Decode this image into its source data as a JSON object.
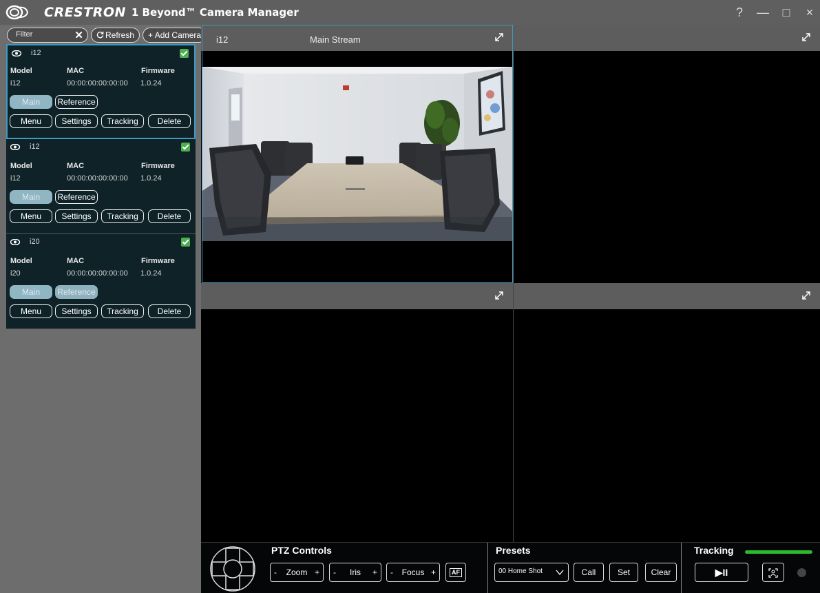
{
  "titlebar": {
    "brand": "CRESTRON",
    "app_title": "1 Beyond™ Camera Manager",
    "help": "?",
    "minimize": "—",
    "maximize": "□",
    "close": "×"
  },
  "toolbar": {
    "filter_placeholder": "Filter",
    "clear": "✕",
    "refresh": "Refresh",
    "add_camera": "+ Add Camera"
  },
  "cameras": [
    {
      "name": "i12",
      "model_label": "Model",
      "mac_label": "MAC",
      "firmware_label": "Firmware",
      "model": "i12",
      "mac": "00:00:00:00:00:00",
      "firmware": "1.0.24",
      "main": "Main",
      "reference": "Reference",
      "menu": "Menu",
      "settings": "Settings",
      "tracking": "Tracking",
      "delete": "Delete"
    },
    {
      "name": "i12",
      "model_label": "Model",
      "mac_label": "MAC",
      "firmware_label": "Firmware",
      "model": "i12",
      "mac": "00:00:00:00:00:00",
      "firmware": "1.0.24",
      "main": "Main",
      "reference": "Reference",
      "menu": "Menu",
      "settings": "Settings",
      "tracking": "Tracking",
      "delete": "Delete"
    },
    {
      "name": "i20",
      "model_label": "Model",
      "mac_label": "MAC",
      "firmware_label": "Firmware",
      "model": "i20",
      "mac": "00:00:00:00:00:00",
      "firmware": "1.0.24",
      "main": "Main",
      "reference": "Reference",
      "menu": "Menu",
      "settings": "Settings",
      "tracking": "Tracking",
      "delete": "Delete"
    }
  ],
  "viewer": {
    "camera": "i12",
    "stream": "Main Stream"
  },
  "ptz": {
    "title": "PTZ Controls",
    "zoom": "Zoom",
    "iris": "Iris",
    "focus": "Focus",
    "minus": "-",
    "plus": "+",
    "af": "AF"
  },
  "presets": {
    "title": "Presets",
    "selected": "00 Home Shot",
    "call": "Call",
    "set": "Set",
    "clear": "Clear"
  },
  "tracking": {
    "title": "Tracking",
    "play_pause": "▶II"
  },
  "colors": {
    "accent": "#3c9ac5",
    "card_bg": "#0e2228",
    "check_green": "#4caf50",
    "tracking_bar": "#2db82d"
  }
}
